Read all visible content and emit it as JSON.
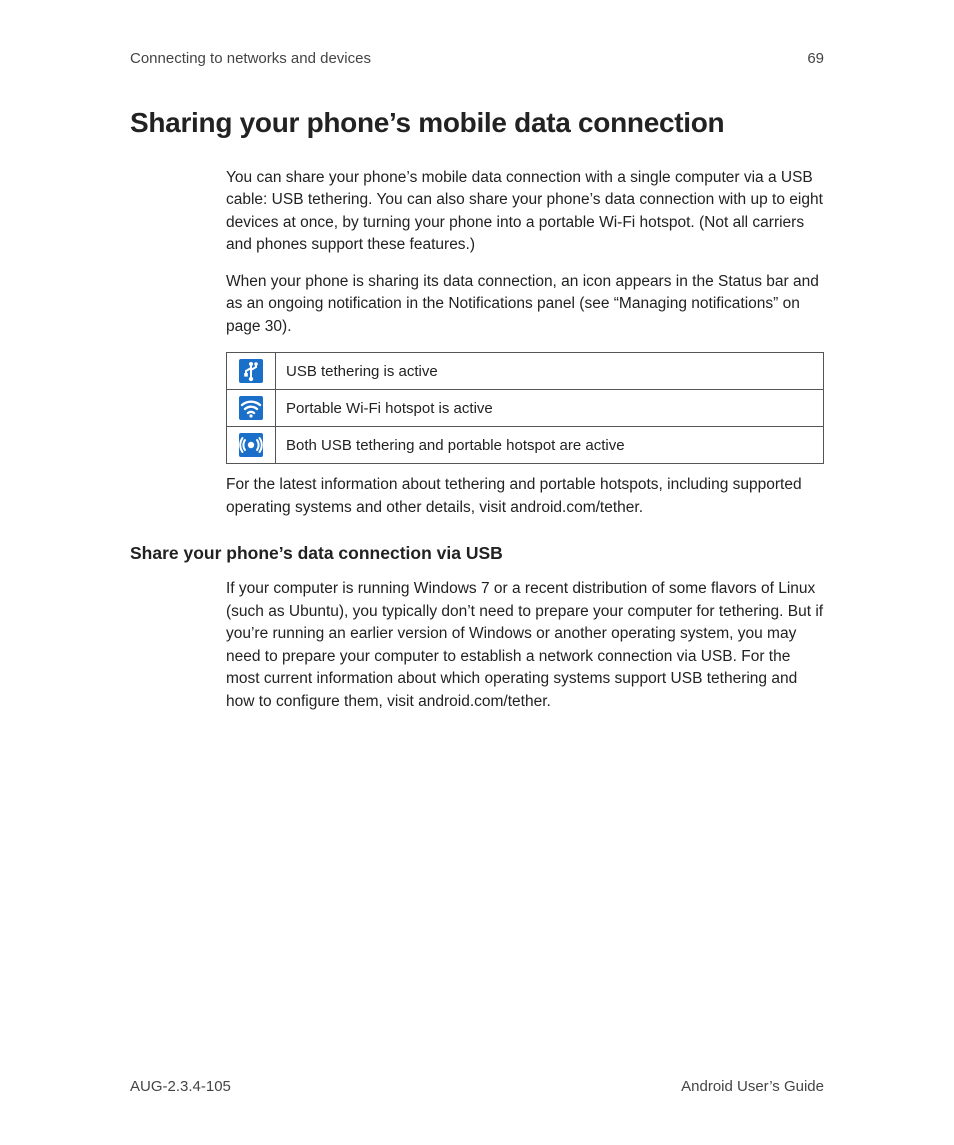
{
  "header": {
    "chapter": "Connecting to networks and devices",
    "page_number": "69"
  },
  "title": "Sharing your phone’s mobile data connection",
  "intro_p1": "You can share your phone’s mobile data connection with a single computer via a USB cable: USB tethering. You can also share your phone’s data connection with up to eight devices at once, by turning your phone into a portable Wi-Fi hotspot. (Not all carriers and phones support these features.)",
  "intro_p2": "When your phone is sharing its data connection, an icon appears in the Status bar and as an ongoing notification in the Notifications panel (see “Managing notifications” on page 30).",
  "icon_table": {
    "rows": [
      {
        "icon": "usb",
        "desc": "USB tethering is active"
      },
      {
        "icon": "wifi",
        "desc": "Portable Wi-Fi hotspot is active"
      },
      {
        "icon": "both",
        "desc": "Both USB tethering and portable hotspot are active"
      }
    ]
  },
  "note_after_table": "For the latest information about tethering and portable hotspots, including supported operating systems and other details, visit android.com/tether.",
  "subheading": "Share your phone’s data connection via USB",
  "sub_p1": "If your computer is running Windows 7 or a recent distribution of some flavors of Linux (such as Ubuntu), you typically don’t need to prepare your computer for tethering. But if you’re running an earlier version of Windows or another operating system, you may need to prepare your computer to establish a network connection via USB. For the most current information about which operating systems support USB tethering and how to configure them, visit android.com/tether.",
  "footer": {
    "left": "AUG-2.3.4-105",
    "right": "Android User’s Guide"
  }
}
